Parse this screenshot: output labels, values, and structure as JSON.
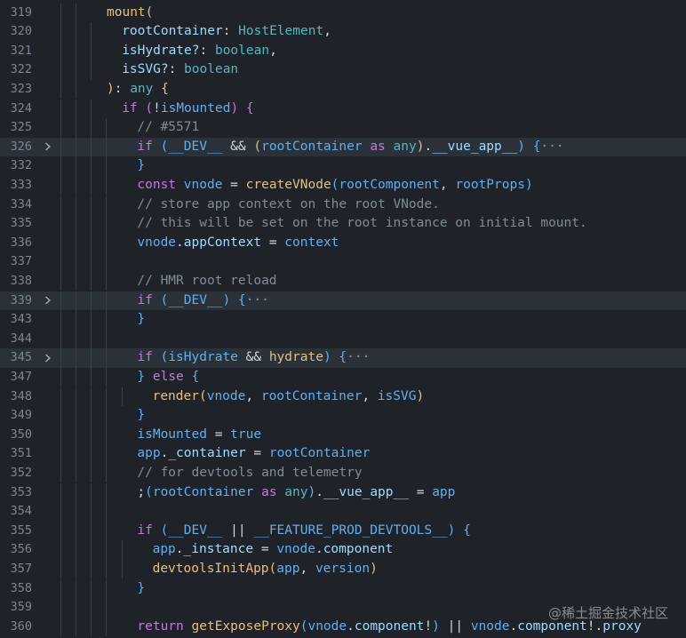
{
  "editor": {
    "watermark": "@稀土掘金技术社区",
    "lines": [
      {
        "ln": "319",
        "indent": 1,
        "fold": false,
        "tokens": [
          [
            "mount",
            "fn"
          ],
          [
            "(",
            "b1"
          ]
        ]
      },
      {
        "ln": "320",
        "indent": 2,
        "fold": false,
        "tokens": [
          [
            "rootContainer",
            "prop"
          ],
          [
            ": ",
            "txt"
          ],
          [
            "HostElement",
            "typ"
          ],
          [
            ",",
            "txt"
          ]
        ]
      },
      {
        "ln": "321",
        "indent": 2,
        "fold": false,
        "tokens": [
          [
            "isHydrate?",
            "prop"
          ],
          [
            ": ",
            "txt"
          ],
          [
            "boolean",
            "typ"
          ],
          [
            ",",
            "txt"
          ]
        ]
      },
      {
        "ln": "322",
        "indent": 2,
        "fold": false,
        "tokens": [
          [
            "isSVG?",
            "prop"
          ],
          [
            ": ",
            "txt"
          ],
          [
            "boolean",
            "typ"
          ]
        ]
      },
      {
        "ln": "323",
        "indent": 1,
        "fold": false,
        "tokens": [
          [
            ")",
            "b1"
          ],
          [
            ": ",
            "txt"
          ],
          [
            "any",
            "typ"
          ],
          [
            " ",
            "txt"
          ],
          [
            "{",
            "b1"
          ]
        ]
      },
      {
        "ln": "324",
        "indent": 2,
        "fold": false,
        "tokens": [
          [
            "if",
            "kw"
          ],
          [
            " ",
            "txt"
          ],
          [
            "(",
            "b2"
          ],
          [
            "!",
            "txt"
          ],
          [
            "isMounted",
            "var"
          ],
          [
            ")",
            "b2"
          ],
          [
            " ",
            "txt"
          ],
          [
            "{",
            "b2"
          ]
        ]
      },
      {
        "ln": "325",
        "indent": 3,
        "fold": false,
        "tokens": [
          [
            "// #5571",
            "cmt"
          ]
        ]
      },
      {
        "ln": "326",
        "indent": 3,
        "fold": true,
        "tokens": [
          [
            "if",
            "kw"
          ],
          [
            " ",
            "txt"
          ],
          [
            "(",
            "b3"
          ],
          [
            "__DEV__",
            "var"
          ],
          [
            " && ",
            "txt"
          ],
          [
            "(",
            "b1"
          ],
          [
            "rootContainer",
            "var"
          ],
          [
            " as ",
            "kw"
          ],
          [
            "any",
            "typ"
          ],
          [
            ")",
            "b1"
          ],
          [
            ".",
            "txt"
          ],
          [
            "__vue_app__",
            "prop"
          ],
          [
            ")",
            "b3"
          ],
          [
            " ",
            "txt"
          ],
          [
            "{",
            "b3"
          ],
          [
            "···",
            "ell"
          ]
        ]
      },
      {
        "ln": "332",
        "indent": 3,
        "fold": false,
        "tokens": [
          [
            "}",
            "b3"
          ]
        ]
      },
      {
        "ln": "333",
        "indent": 3,
        "fold": false,
        "tokens": [
          [
            "const",
            "kw"
          ],
          [
            " ",
            "txt"
          ],
          [
            "vnode",
            "var"
          ],
          [
            " = ",
            "txt"
          ],
          [
            "createVNode",
            "fn"
          ],
          [
            "(",
            "b3"
          ],
          [
            "rootComponent",
            "var"
          ],
          [
            ", ",
            "txt"
          ],
          [
            "rootProps",
            "var"
          ],
          [
            ")",
            "b3"
          ]
        ]
      },
      {
        "ln": "334",
        "indent": 3,
        "fold": false,
        "tokens": [
          [
            "// store app context on the root VNode.",
            "cmt"
          ]
        ]
      },
      {
        "ln": "335",
        "indent": 3,
        "fold": false,
        "tokens": [
          [
            "// this will be set on the root instance on initial mount.",
            "cmt"
          ]
        ]
      },
      {
        "ln": "336",
        "indent": 3,
        "fold": false,
        "tokens": [
          [
            "vnode",
            "var"
          ],
          [
            ".",
            "txt"
          ],
          [
            "appContext",
            "prop"
          ],
          [
            " = ",
            "txt"
          ],
          [
            "context",
            "var"
          ]
        ]
      },
      {
        "ln": "337",
        "indent": 3,
        "fold": false,
        "tokens": []
      },
      {
        "ln": "338",
        "indent": 3,
        "fold": false,
        "tokens": [
          [
            "// HMR root reload",
            "cmt"
          ]
        ]
      },
      {
        "ln": "339",
        "indent": 3,
        "fold": true,
        "tokens": [
          [
            "if",
            "kw"
          ],
          [
            " ",
            "txt"
          ],
          [
            "(",
            "b3"
          ],
          [
            "__DEV__",
            "var"
          ],
          [
            ")",
            "b3"
          ],
          [
            " ",
            "txt"
          ],
          [
            "{",
            "b3"
          ],
          [
            "···",
            "ell"
          ]
        ]
      },
      {
        "ln": "343",
        "indent": 3,
        "fold": false,
        "tokens": [
          [
            "}",
            "b3"
          ]
        ]
      },
      {
        "ln": "344",
        "indent": 3,
        "fold": false,
        "tokens": []
      },
      {
        "ln": "345",
        "indent": 3,
        "fold": true,
        "tokens": [
          [
            "if",
            "kw"
          ],
          [
            " ",
            "txt"
          ],
          [
            "(",
            "b3"
          ],
          [
            "isHydrate",
            "var"
          ],
          [
            " && ",
            "txt"
          ],
          [
            "hydrate",
            "fn"
          ],
          [
            ")",
            "b3"
          ],
          [
            " ",
            "txt"
          ],
          [
            "{",
            "b3"
          ],
          [
            "···",
            "ell"
          ]
        ]
      },
      {
        "ln": "347",
        "indent": 3,
        "fold": false,
        "tokens": [
          [
            "}",
            "b3"
          ],
          [
            " ",
            "txt"
          ],
          [
            "else",
            "kw"
          ],
          [
            " ",
            "txt"
          ],
          [
            "{",
            "b3"
          ]
        ]
      },
      {
        "ln": "348",
        "indent": 4,
        "fold": false,
        "tokens": [
          [
            "render",
            "fn"
          ],
          [
            "(",
            "b1"
          ],
          [
            "vnode",
            "var"
          ],
          [
            ", ",
            "txt"
          ],
          [
            "rootContainer",
            "var"
          ],
          [
            ", ",
            "txt"
          ],
          [
            "isSVG",
            "var"
          ],
          [
            ")",
            "b1"
          ]
        ]
      },
      {
        "ln": "349",
        "indent": 3,
        "fold": false,
        "tokens": [
          [
            "}",
            "b3"
          ]
        ]
      },
      {
        "ln": "350",
        "indent": 3,
        "fold": false,
        "tokens": [
          [
            "isMounted",
            "var"
          ],
          [
            " = ",
            "txt"
          ],
          [
            "true",
            "var"
          ]
        ]
      },
      {
        "ln": "351",
        "indent": 3,
        "fold": false,
        "tokens": [
          [
            "app",
            "var"
          ],
          [
            ".",
            "txt"
          ],
          [
            "_container",
            "prop"
          ],
          [
            " = ",
            "txt"
          ],
          [
            "rootContainer",
            "var"
          ]
        ]
      },
      {
        "ln": "352",
        "indent": 3,
        "fold": false,
        "tokens": [
          [
            "// for devtools and telemetry",
            "cmt"
          ]
        ]
      },
      {
        "ln": "353",
        "indent": 3,
        "fold": false,
        "tokens": [
          [
            ";",
            "txt"
          ],
          [
            "(",
            "b3"
          ],
          [
            "rootContainer",
            "var"
          ],
          [
            " as ",
            "kw"
          ],
          [
            "any",
            "typ"
          ],
          [
            ")",
            "b3"
          ],
          [
            ".",
            "txt"
          ],
          [
            "__vue_app__",
            "prop"
          ],
          [
            " = ",
            "txt"
          ],
          [
            "app",
            "var"
          ]
        ]
      },
      {
        "ln": "354",
        "indent": 3,
        "fold": false,
        "tokens": []
      },
      {
        "ln": "355",
        "indent": 3,
        "fold": false,
        "tokens": [
          [
            "if",
            "kw"
          ],
          [
            " ",
            "txt"
          ],
          [
            "(",
            "b3"
          ],
          [
            "__DEV__",
            "var"
          ],
          [
            " || ",
            "txt"
          ],
          [
            "__FEATURE_PROD_DEVTOOLS__",
            "var"
          ],
          [
            ")",
            "b3"
          ],
          [
            " ",
            "txt"
          ],
          [
            "{",
            "b3"
          ]
        ]
      },
      {
        "ln": "356",
        "indent": 4,
        "fold": false,
        "tokens": [
          [
            "app",
            "var"
          ],
          [
            ".",
            "txt"
          ],
          [
            "_instance",
            "prop"
          ],
          [
            " = ",
            "txt"
          ],
          [
            "vnode",
            "var"
          ],
          [
            ".",
            "txt"
          ],
          [
            "component",
            "prop"
          ]
        ]
      },
      {
        "ln": "357",
        "indent": 4,
        "fold": false,
        "tokens": [
          [
            "devtoolsInitApp",
            "fn"
          ],
          [
            "(",
            "b1"
          ],
          [
            "app",
            "var"
          ],
          [
            ", ",
            "txt"
          ],
          [
            "version",
            "var"
          ],
          [
            ")",
            "b1"
          ]
        ]
      },
      {
        "ln": "358",
        "indent": 3,
        "fold": false,
        "tokens": [
          [
            "}",
            "b3"
          ]
        ]
      },
      {
        "ln": "359",
        "indent": 3,
        "fold": false,
        "tokens": []
      },
      {
        "ln": "360",
        "indent": 3,
        "fold": false,
        "tokens": [
          [
            "return",
            "kw"
          ],
          [
            " ",
            "txt"
          ],
          [
            "getExposeProxy",
            "fn"
          ],
          [
            "(",
            "b3"
          ],
          [
            "vnode",
            "var"
          ],
          [
            ".",
            "txt"
          ],
          [
            "component",
            "prop"
          ],
          [
            "!",
            "txt"
          ],
          [
            ")",
            "b3"
          ],
          [
            " || ",
            "txt"
          ],
          [
            "vnode",
            "var"
          ],
          [
            ".",
            "txt"
          ],
          [
            "component",
            "prop"
          ],
          [
            "!",
            "txt"
          ],
          [
            ".",
            "txt"
          ],
          [
            "proxy",
            "prop"
          ]
        ]
      }
    ]
  }
}
